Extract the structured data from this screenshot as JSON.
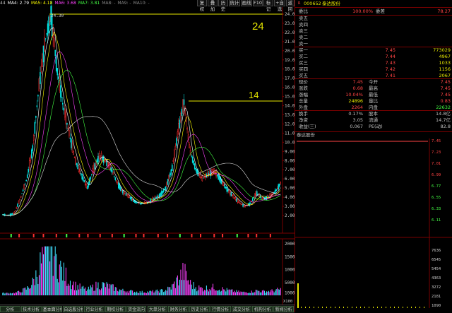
{
  "toolbar": {
    "buttons": [
      "复权",
      "叠加",
      "历史",
      "统计",
      "画线",
      "F10",
      "标记",
      "+自选",
      "返回"
    ]
  },
  "ma_legend": {
    "items": [
      {
        "text": "44",
        "color": "#c0c0c0"
      },
      {
        "text": "MA4: 2.79",
        "color": "#ffffff"
      },
      {
        "text": "MA5: 4.18",
        "color": "#ffff00"
      },
      {
        "text": "MA6: 3.68",
        "color": "#ff44ff"
      },
      {
        "text": "MA7: 3.81",
        "color": "#44ff44"
      },
      {
        "text": "MA8: -",
        "color": "#888888"
      },
      {
        "text": "MA9: -",
        "color": "#888888"
      },
      {
        "text": "MA10: -",
        "color": "#888888"
      }
    ]
  },
  "price_axis": {
    "labels": [
      "24.00",
      "23.00",
      "22.00",
      "21.00",
      "20.00",
      "19.00",
      "18.00",
      "17.00",
      "16.00",
      "15.00",
      "14.00",
      "13.00",
      "12.00",
      "11.00",
      "10.00",
      "9.00",
      "8.00",
      "7.00",
      "6.00",
      "5.00",
      "4.00",
      "3.00",
      "2.00"
    ],
    "high_label": "24.30"
  },
  "annotations": {
    "peak_1": "24",
    "peak_2": "14"
  },
  "volume_axis": {
    "labels": [
      "20000",
      "15000",
      "10000",
      "5000",
      "1000"
    ],
    "unit": "X100"
  },
  "stock": {
    "code": "000652",
    "name": "泰达股份",
    "ratio_label": "委比",
    "ratio_value": "100.00%",
    "diff_label": "委差",
    "diff_value": "78.27"
  },
  "asks": [
    {
      "label": "卖五",
      "price": "",
      "volume": ""
    },
    {
      "label": "卖四",
      "price": "",
      "volume": ""
    },
    {
      "label": "卖三",
      "price": "",
      "volume": ""
    },
    {
      "label": "卖二",
      "price": "",
      "volume": ""
    },
    {
      "label": "卖一",
      "price": "",
      "volume": ""
    }
  ],
  "bids": [
    {
      "label": "买一",
      "price": "7.45",
      "volume": "773029"
    },
    {
      "label": "买二",
      "price": "7.44",
      "volume": "4967"
    },
    {
      "label": "买三",
      "price": "7.43",
      "volume": "1033"
    },
    {
      "label": "买四",
      "price": "7.42",
      "volume": "1156"
    },
    {
      "label": "买五",
      "price": "7.41",
      "volume": "2067"
    }
  ],
  "quote": [
    {
      "l": "现价",
      "v": "7.45",
      "lc": "#ff4444",
      "m": "今开",
      "mv": "7.45",
      "mc": "#ff4444"
    },
    {
      "l": "涨跌",
      "v": "0.68",
      "lc": "#ff4444",
      "m": "最高",
      "mv": "7.45",
      "mc": "#ff4444"
    },
    {
      "l": "涨幅",
      "v": "10.04%",
      "lc": "#ff4444",
      "m": "最低",
      "mv": "7.45",
      "mc": "#ff4444"
    },
    {
      "l": "总量",
      "v": "24896",
      "lc": "#e6e600",
      "m": "量比",
      "mv": "0.83",
      "mc": "#ff4444"
    },
    {
      "l": "外盘",
      "v": "2264",
      "lc": "#ff4444",
      "m": "内盘",
      "mv": "22632",
      "mc": "#44ff44"
    }
  ],
  "fundamentals": [
    {
      "l": "换手",
      "v": "0.17%",
      "m": "股本",
      "mv": "14.8亿"
    },
    {
      "l": "净资",
      "v": "3.05",
      "m": "流通",
      "mv": "14.7亿"
    },
    {
      "l": "收益(三)",
      "v": "0.067",
      "m": "PE(动)",
      "mv": "82.8"
    }
  ],
  "intraday": {
    "title": "泰达股份",
    "price_labels": [
      "7.45",
      "7.23",
      "7.01",
      "6.99",
      "6.77",
      "6.55",
      "6.33",
      "6.11"
    ],
    "volume_labels": [
      "7636",
      "6545",
      "5454",
      "4363",
      "3272",
      "2181",
      "1090"
    ]
  },
  "bottom_tabs": [
    "分析",
    "技术分析",
    "基本面分析",
    "自选股分析",
    "行业分析",
    "期权分析",
    "资金流向",
    "大单分析",
    "财务分析",
    "历史分析",
    "行情分析",
    "成交分析",
    "机构分析",
    "新闻分析"
  ],
  "chart_data": {
    "type": "line",
    "note_series": [
      {
        "name": "close",
        "values": [
          2.1,
          2.0,
          2.3,
          4.0,
          6.0,
          9.5,
          16.0,
          21.0,
          24.0,
          18.0,
          14.0,
          11.0,
          8.0,
          6.5,
          5.0,
          7.0,
          8.5,
          8.0,
          7.0,
          5.5,
          4.5,
          4.0,
          3.5,
          3.3,
          3.4,
          3.8,
          4.2,
          5.0,
          7.0,
          11.0,
          14.5,
          9.0,
          7.0,
          6.0,
          6.5,
          6.8,
          6.0,
          5.0,
          4.2,
          3.5,
          3.0,
          3.3,
          4.5,
          3.8,
          4.0,
          4.5,
          5.5
        ]
      }
    ],
    "ylim": [
      1.5,
      24.5
    ]
  }
}
